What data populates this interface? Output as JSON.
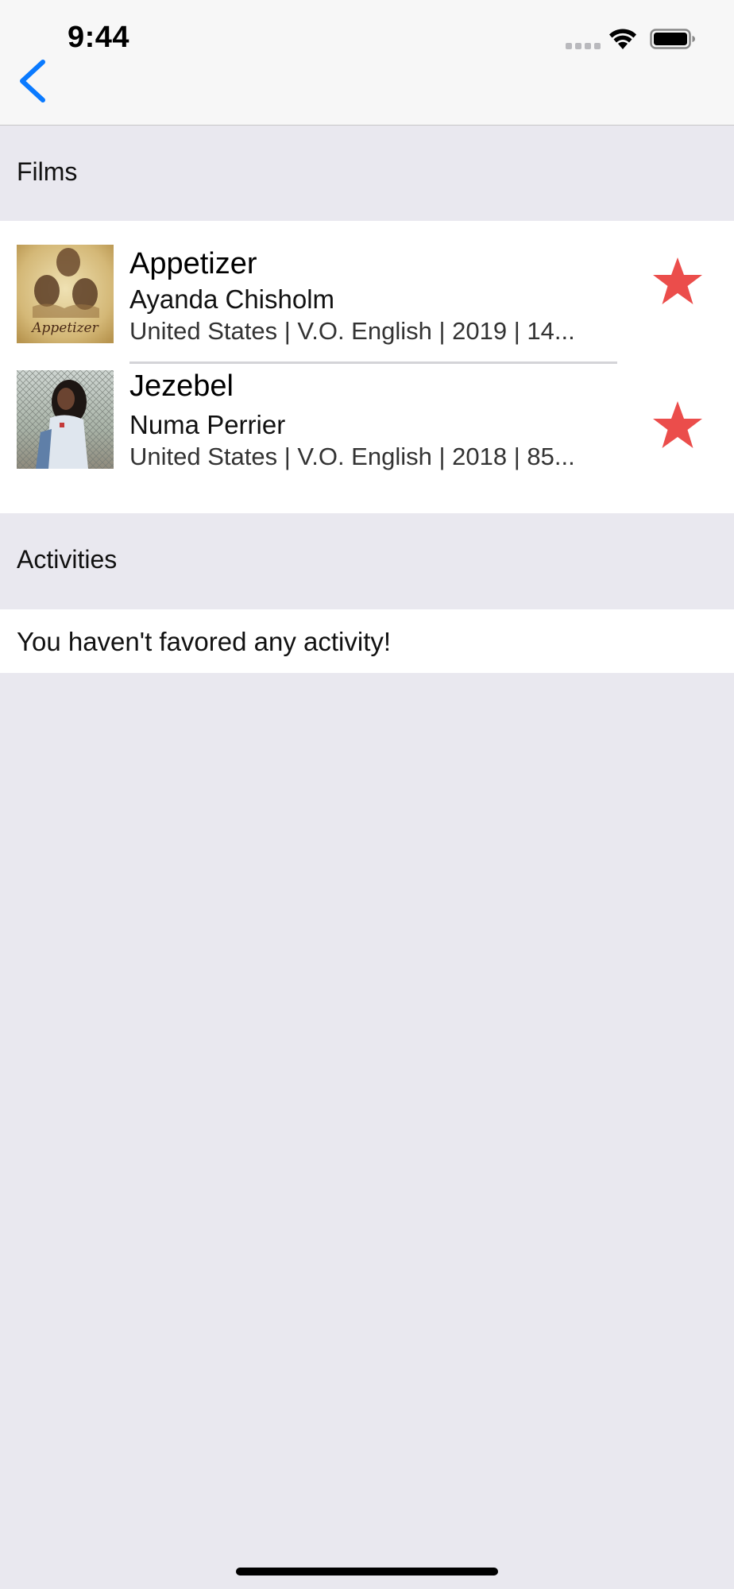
{
  "status_bar": {
    "time": "9:44"
  },
  "nav": {
    "back_icon": "chevron-left-icon",
    "accent_color": "#0a7aff"
  },
  "films_section": {
    "header": "Films",
    "items": [
      {
        "title": "Appetizer",
        "director": "Ayanda Chisholm",
        "meta": "United States | V.O. English | 2019 | 14...",
        "favorite": true,
        "poster_text": "Appetizer"
      },
      {
        "title": "Jezebel",
        "director": "Numa Perrier",
        "meta": "United States | V.O. English | 2018 | 85...",
        "favorite": true
      }
    ]
  },
  "activities_section": {
    "header": "Activities",
    "empty_message": "You haven't favored any activity!"
  },
  "colors": {
    "star": "#eb4d4b",
    "background": "#e9e8ef"
  }
}
